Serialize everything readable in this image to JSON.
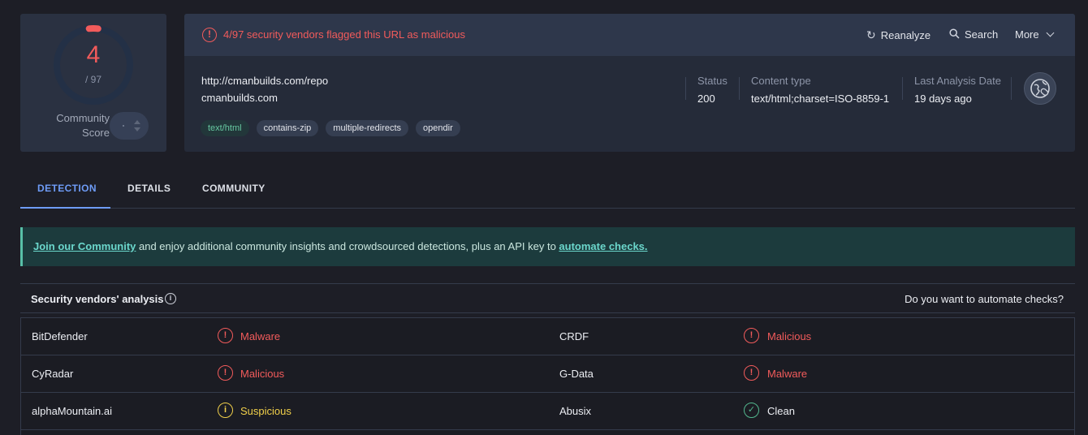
{
  "score": {
    "detections": "4",
    "total": "/ 97",
    "community_label_1": "Community",
    "community_label_2": "Score",
    "ratio": 0.0412,
    "accent": "#f25b5b"
  },
  "alert": {
    "text": "4/97 security vendors flagged this URL as malicious",
    "icon": "alert-circle-icon"
  },
  "actions": {
    "reanalyze": "Reanalyze",
    "search": "Search",
    "more": "More"
  },
  "target": {
    "url": "http://cmanbuilds.com/repo",
    "domain": "cmanbuilds.com",
    "tags": [
      "text/html",
      "contains-zip",
      "multiple-redirects",
      "opendir"
    ]
  },
  "meta": {
    "status_label": "Status",
    "status_value": "200",
    "content_type_label": "Content type",
    "content_type_value": "text/html;charset=ISO-8859-1",
    "last_analysis_label": "Last Analysis Date",
    "last_analysis_value": "19 days ago"
  },
  "tabs": [
    "DETECTION",
    "DETAILS",
    "COMMUNITY"
  ],
  "banner": {
    "link1": "Join our Community",
    "middle": " and enjoy additional community insights and crowdsourced detections, plus an API key to ",
    "link2": "automate checks."
  },
  "vendors": {
    "title": "Security vendors' analysis",
    "automate_question": "Do you want to automate checks?",
    "rows": [
      {
        "v1": "BitDefender",
        "r1": "Malware",
        "v2": "CRDF",
        "r2": "Malicious"
      },
      {
        "v1": "CyRadar",
        "r1": "Malicious",
        "v2": "G-Data",
        "r2": "Malware"
      },
      {
        "v1": "alphaMountain.ai",
        "r1": "Suspicious",
        "v2": "Abusix",
        "r2": "Clean"
      }
    ]
  }
}
